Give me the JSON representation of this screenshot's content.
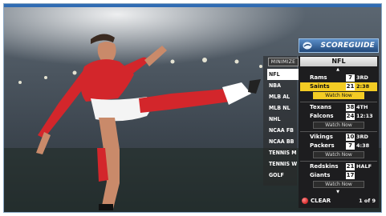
{
  "scoreguide": {
    "logo_text": "SCOREGUIDE"
  },
  "sidebar": {
    "minimize_label": "MINIMIZE",
    "items": [
      {
        "label": "NFL",
        "active": true
      },
      {
        "label": "NBA"
      },
      {
        "label": "MLB AL"
      },
      {
        "label": "MLB NL"
      },
      {
        "label": "NHL"
      },
      {
        "label": "NCAA FB"
      },
      {
        "label": "NCAA BB"
      },
      {
        "label": "TENNIS M"
      },
      {
        "label": "TENNIS W"
      },
      {
        "label": "GOLF"
      }
    ]
  },
  "panel": {
    "league_title": "NFL",
    "games": [
      {
        "team1": "Rams",
        "score1": "7",
        "status1": "3RD",
        "team2": "Saints",
        "score2": "21",
        "status2": "2:38",
        "watch_label": "Watch Now",
        "selected": true
      },
      {
        "team1": "Texans",
        "score1": "38",
        "status1": "4TH",
        "team2": "Falcons",
        "score2": "24",
        "status2": "12:13",
        "watch_label": "Watch Now"
      },
      {
        "team1": "Vikings",
        "score1": "10",
        "status1": "3RD",
        "team2": "Packers",
        "score2": "7",
        "status2": "4:38",
        "watch_label": "Watch Now"
      },
      {
        "team1": "Redskins",
        "score1": "21",
        "status1": "HALF",
        "team2": "Giants",
        "score2": "17",
        "status2": "",
        "watch_label": "Watch Now"
      }
    ]
  },
  "footer": {
    "clear_label": "CLEAR",
    "page_label": "1 of 9"
  },
  "icons": {
    "clear": "red-circle-button-icon",
    "logo": "dish-logo-icon",
    "scroll_up": "scroll-up-arrow-icon",
    "scroll_down": "scroll-down-arrow-icon"
  },
  "colors": {
    "highlight": "#f3cc24",
    "panel": "#1d1d1f",
    "logo_blue": "#21487a",
    "clear_button": "#c40000"
  }
}
